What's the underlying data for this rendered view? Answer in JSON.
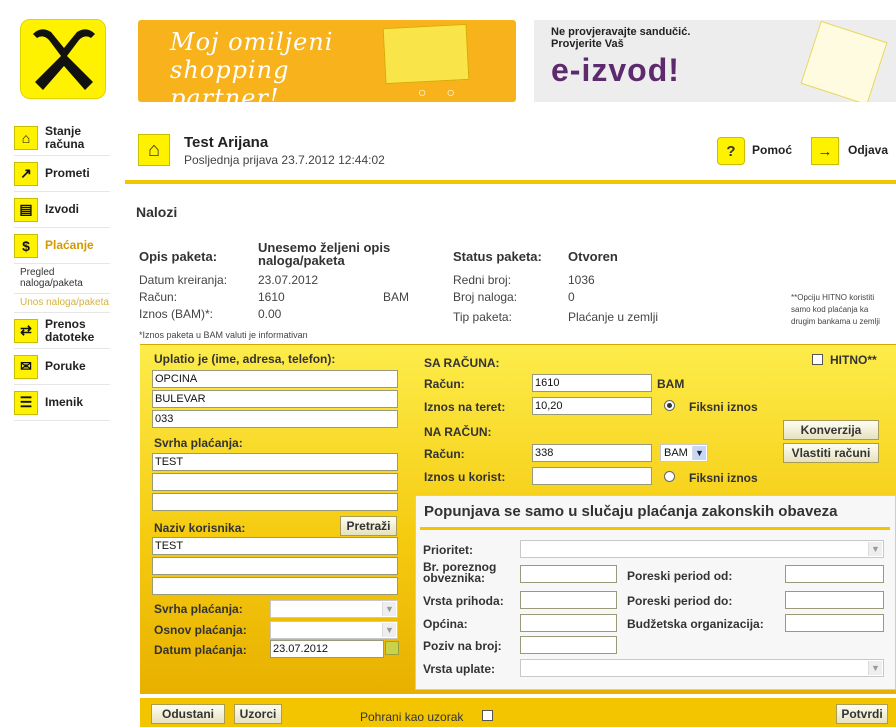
{
  "nav": {
    "items": [
      {
        "label": "Stanje računa",
        "icon": "home-icon"
      },
      {
        "label": "Prometi",
        "icon": "trend-arrow-icon"
      },
      {
        "label": "Izvodi",
        "icon": "document-icon"
      },
      {
        "label": "Plaćanje",
        "icon": "payment-icon"
      },
      {
        "label": "Prenos datoteke",
        "icon": "transfer-icon"
      },
      {
        "label": "Poruke",
        "icon": "envelope-icon"
      },
      {
        "label": "Imenik",
        "icon": "addressbook-icon"
      }
    ],
    "sub": [
      "Pregled naloga/paketa",
      "Unos naloga/paketa"
    ]
  },
  "banners": {
    "shopping": "Moj omiljeni shopping partner!",
    "eizvod_small": "Ne provjeravajte sandučić. Provjerite Vaš",
    "eizvod_big": "e-izvod!"
  },
  "user": {
    "name": "Test Arijana",
    "last_login": "Posljednja prijava 23.7.2012 12:44:02",
    "help": "Pomoć",
    "logout": "Odjava"
  },
  "page_title": "Nalozi",
  "package": {
    "opis_label": "Opis paketa:",
    "opis_value": "Unesemo željeni opis naloga/paketa",
    "datum_label": "Datum kreiranja:",
    "datum_value": "23.07.2012",
    "racun_label": "Račun:",
    "racun_value": "1610",
    "racun_currency": "BAM",
    "iznos_label": "Iznos (BAM)*:",
    "iznos_value": "0.00",
    "note": "*Iznos paketa u BAM valuti je informativan",
    "status_label": "Status paketa:",
    "status_value": "Otvoren",
    "redni_label": "Redni broj:",
    "redni_value": "1036",
    "broj_label": "Broj naloga:",
    "broj_value": "0",
    "tip_label": "Tip paketa:",
    "tip_value": "Plaćanje u zemlji",
    "hitno_note": "**Opciju HITNO koristiti samo kod plaćanja ka drugim bankama u zemlji"
  },
  "form": {
    "uplatio_label": "Uplatio je (ime, adresa, telefon):",
    "uplatio_values": [
      "OPCINA",
      "BULEVAR",
      "033"
    ],
    "svrha_label": "Svrha plaćanja:",
    "svrha_values": [
      "TEST",
      "",
      ""
    ],
    "naziv_label": "Naziv korisnika:",
    "pretrazi": "Pretraži",
    "naziv_values": [
      "TEST",
      "",
      ""
    ],
    "svrha_sel_label": "Svrha plaćanja:",
    "osnov_label": "Osnov plaćanja:",
    "datum_label": "Datum plaćanja:",
    "datum_value": "23.07.2012",
    "sa_racuna": "SA RAČUNA:",
    "racun_label": "Račun:",
    "racun_value": "1610",
    "racun_currency": "BAM",
    "teret_label": "Iznos na teret:",
    "teret_value": "10,20",
    "fiksni": "Fiksni iznos",
    "na_racun": "NA RAČUN:",
    "na_racun_value": "338",
    "na_currency": "BAM",
    "korist_label": "Iznos u korist:",
    "korist_value": "",
    "fiksni2": "Fiksni iznos",
    "hitno": "HITNO**",
    "konverzija": "Konverzija",
    "vlastiti": "Vlastiti računi"
  },
  "tax": {
    "title": "Popunjava se samo u slučaju plaćanja zakonskih obaveza",
    "prioritet": "Prioritet:",
    "br_poreznog": "Br. poreznog obveznika:",
    "vrsta_prihoda": "Vrsta prihoda:",
    "opcina": "Općina:",
    "poziv": "Poziv na broj:",
    "vrsta_uplate": "Vrsta uplate:",
    "period_od": "Poreski period od:",
    "period_do": "Poreski period do:",
    "budzetska": "Budžetska organizacija:"
  },
  "footer": {
    "odustani": "Odustani",
    "uzorci": "Uzorci",
    "pohrani": "Pohrani kao uzorak",
    "potvrdi": "Potvrdi"
  }
}
